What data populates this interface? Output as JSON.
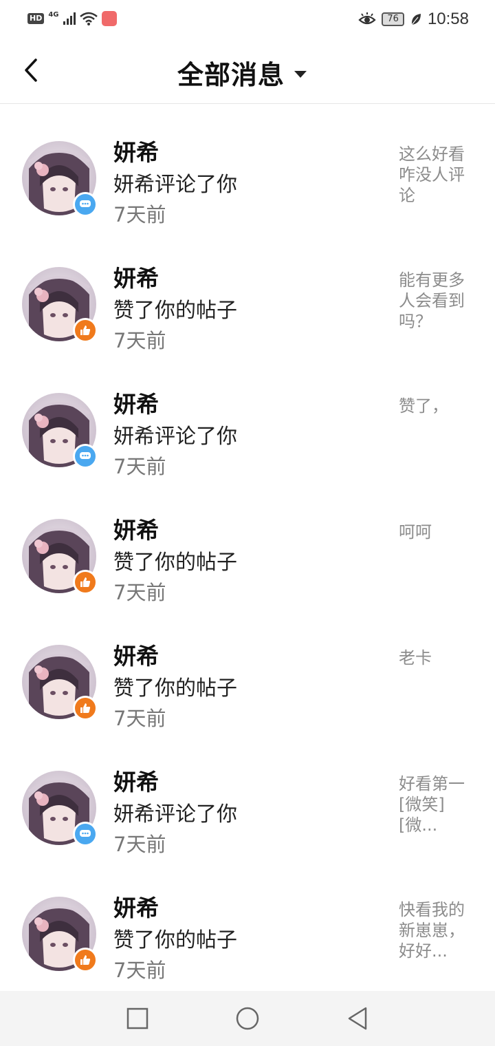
{
  "status_bar": {
    "hd": "HD",
    "network": "4G",
    "battery": "76",
    "time": "10:58"
  },
  "header": {
    "title": "全部消息"
  },
  "messages": [
    {
      "name": "妍希",
      "action": "妍希评论了你",
      "time": "7天前",
      "preview": "这么好看咋没人评论",
      "type": "comment"
    },
    {
      "name": "妍希",
      "action": "赞了你的帖子",
      "time": "7天前",
      "preview": "能有更多人会看到吗？",
      "type": "like"
    },
    {
      "name": "妍希",
      "action": "妍希评论了你",
      "time": "7天前",
      "preview": "赞了，",
      "type": "comment"
    },
    {
      "name": "妍希",
      "action": "赞了你的帖子",
      "time": "7天前",
      "preview": "呵呵",
      "type": "like"
    },
    {
      "name": "妍希",
      "action": "赞了你的帖子",
      "time": "7天前",
      "preview": "老卡",
      "type": "like"
    },
    {
      "name": "妍希",
      "action": "妍希评论了你",
      "time": "7天前",
      "preview": "好看第一[微笑][微...",
      "type": "comment"
    },
    {
      "name": "妍希",
      "action": "赞了你的帖子",
      "time": "7天前",
      "preview": "快看我的新崽崽，好好...",
      "type": "like"
    }
  ],
  "colors": {
    "comment_badge": "#4aa8f0",
    "like_badge": "#f07a1c"
  }
}
